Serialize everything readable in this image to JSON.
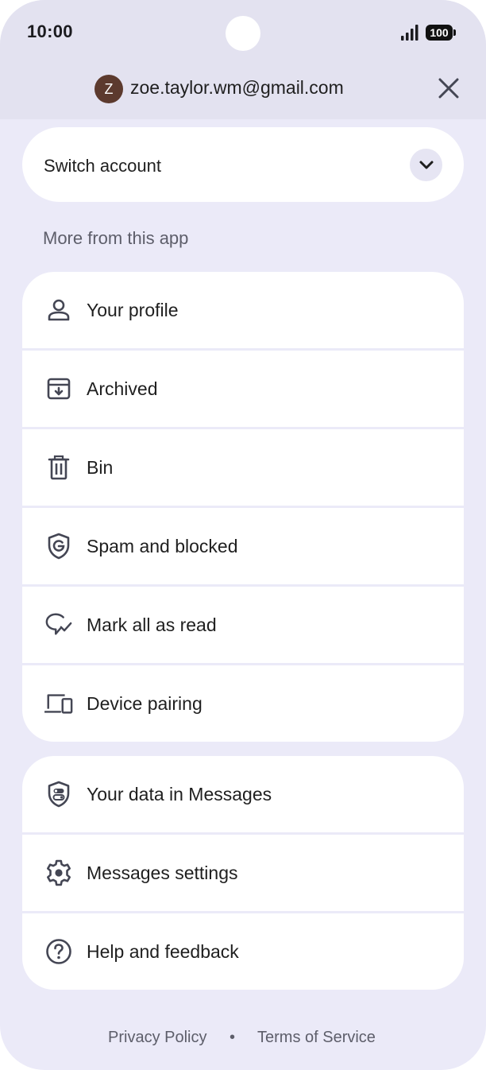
{
  "status_bar": {
    "time": "10:00",
    "battery": "100",
    "signal_icon": "cellular-signal-icon"
  },
  "account": {
    "avatar_initial": "Z",
    "avatar_color": "#5c3a2e",
    "email": "zoe.taylor.wm@gmail.com",
    "close_icon": "close-icon"
  },
  "switch_account": {
    "label": "Switch account",
    "icon": "chevron-down-icon"
  },
  "more_section": {
    "header": "More from this app",
    "items": [
      {
        "label": "Your profile",
        "icon": "person-icon"
      },
      {
        "label": "Archived",
        "icon": "archive-icon"
      },
      {
        "label": "Bin",
        "icon": "trash-icon"
      },
      {
        "label": "Spam and blocked",
        "icon": "shield-g-icon"
      },
      {
        "label": "Mark all as read",
        "icon": "chat-check-icon"
      },
      {
        "label": "Device pairing",
        "icon": "devices-icon"
      }
    ]
  },
  "settings_section": {
    "items": [
      {
        "label": "Your data in Messages",
        "icon": "shield-toggle-icon"
      },
      {
        "label": "Messages settings",
        "icon": "gear-icon"
      },
      {
        "label": "Help and feedback",
        "icon": "help-icon"
      }
    ]
  },
  "footer": {
    "privacy": "Privacy Policy",
    "separator": "•",
    "terms": "Terms of Service"
  },
  "colors": {
    "background": "#ebeaf8",
    "header": "#e3e2f0",
    "card": "#ffffff"
  }
}
